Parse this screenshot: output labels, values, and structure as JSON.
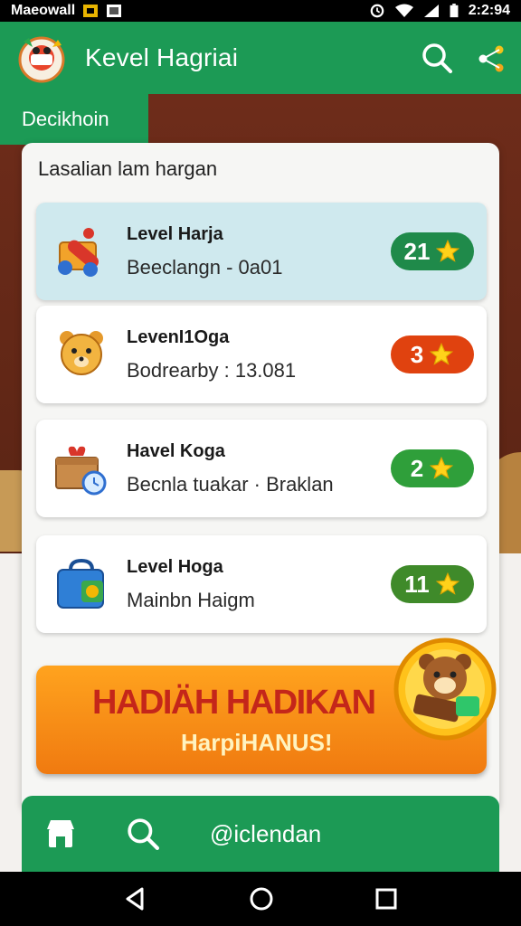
{
  "status_bar": {
    "carrier": "Mаеоwall",
    "time": "2:2:94"
  },
  "app_bar": {
    "title": "Kevel Hagriai",
    "logo_icon": "mascot-logo-icon",
    "search_icon": "search-icon",
    "share_icon": "share-icon"
  },
  "section_tab": {
    "label": "Decikhoin"
  },
  "card": {
    "title": "Lasalian lam hargan",
    "levels": [
      {
        "name": "Level Harja",
        "subtitle": "Beeclangn - 0a01",
        "badge": "21",
        "badge_color": "#1f8a4a",
        "icon": "toy-cannon-icon"
      },
      {
        "name": "LevenI1Oga",
        "subtitle": "Bodrearby : 13.081",
        "badge": "3",
        "badge_color": "#e0420f",
        "icon": "bear-mascot-icon"
      },
      {
        "name": "Havel Koga",
        "subtitle": "Becnla tuakar · Braklan",
        "badge": "2",
        "badge_color": "#2f9f3a",
        "icon": "gift-box-clock-icon"
      },
      {
        "name": "Level Hoga",
        "subtitle": "Mainbn Haigm",
        "badge": "11",
        "badge_color": "#3f8a2a",
        "icon": "blue-bag-icon"
      }
    ]
  },
  "promo": {
    "title": "HADIÄH HADIKAN",
    "subtitle": "HarpiHANUS!",
    "mascot_icon": "bear-chest-icon"
  },
  "bottom_bar": {
    "label": "@iclendan",
    "home_icon": "store-icon",
    "search_icon": "search-icon"
  },
  "nav_bar": {
    "back_icon": "back-icon",
    "home_icon": "home-icon",
    "recents_icon": "recents-icon"
  },
  "colors": {
    "primary_green": "#1c9a55",
    "promo_orange": "#f5901a",
    "promo_red": "#c4261a"
  }
}
